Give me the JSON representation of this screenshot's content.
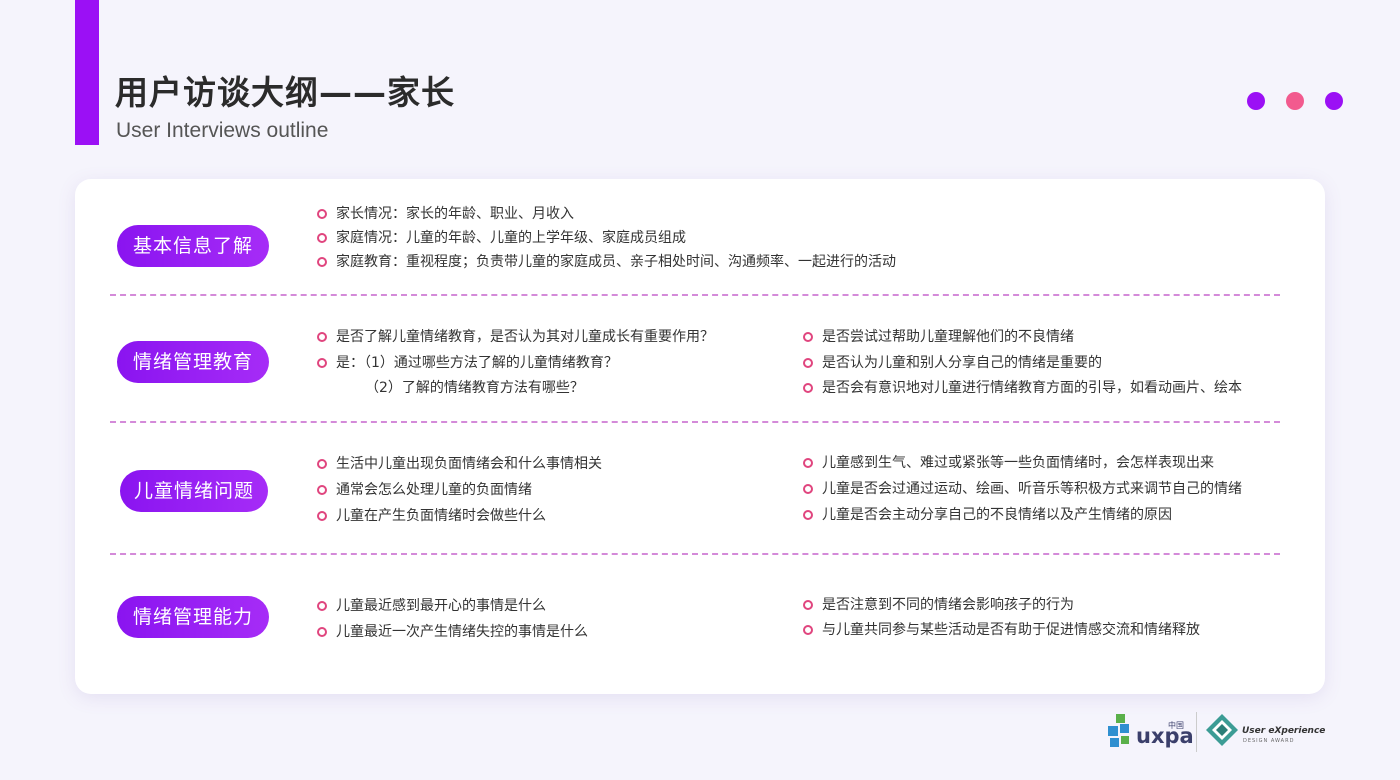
{
  "header": {
    "title": "用户访谈大纲——家长",
    "subtitle": "User Interviews outline",
    "accent_color": "#9b10f5",
    "dot_colors": [
      "#9b10f5",
      "#f25a8e",
      "#9b10f5"
    ]
  },
  "sections": [
    {
      "label": "基本信息了解",
      "left": [
        "家长情况：家长的年龄、职业、月收入",
        "家庭情况：儿童的年龄、儿童的上学年级、家庭成员组成",
        "家庭教育：重视程度；负责带儿童的家庭成员、亲子相处时间、沟通频率、一起进行的活动"
      ],
      "right": []
    },
    {
      "label": "情绪管理教育",
      "left": [
        "是否了解儿童情绪教育，是否认为其对儿童成长有重要作用？",
        "是：（1）通过哪些方法了解的儿童情绪教育？"
      ],
      "left_continuation": "（2）了解的情绪教育方法有哪些？",
      "right": [
        "是否尝试过帮助儿童理解他们的不良情绪",
        "是否认为儿童和别人分享自己的情绪是重要的",
        "是否会有意识地对儿童进行情绪教育方面的引导，如看动画片、绘本"
      ]
    },
    {
      "label": "儿童情绪问题",
      "left": [
        "生活中儿童出现负面情绪会和什么事情相关",
        "通常会怎么处理儿童的负面情绪",
        "儿童在产生负面情绪时会做些什么"
      ],
      "right": [
        "儿童感到生气、难过或紧张等一些负面情绪时，会怎样表现出来",
        "儿童是否会过通过运动、绘画、听音乐等积极方式来调节自己的情绪",
        "儿童是否会主动分享自己的不良情绪以及产生情绪的原因"
      ]
    },
    {
      "label": "情绪管理能力",
      "left": [
        "儿童最近感到最开心的事情是什么",
        "儿童最近一次产生情绪失控的事情是什么"
      ],
      "right": [
        "是否注意到不同的情绪会影响孩子的行为",
        "与儿童共同参与某些活动是否有助于促进情感交流和情绪释放"
      ]
    }
  ],
  "footer": {
    "uxpa_logo_text": "uxpa",
    "uxpa_logo_cn": "中国",
    "award_logo_title": "User eXperience",
    "award_logo_sub": "DESIGN AWARD"
  }
}
